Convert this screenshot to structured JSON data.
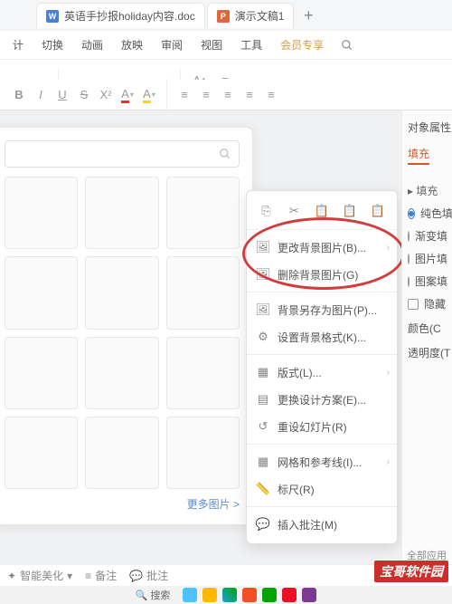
{
  "tabs": [
    {
      "icon": "W",
      "title": "英语手抄报holiday内容.doc"
    },
    {
      "icon": "P",
      "title": "演示文稿1"
    }
  ],
  "addTab": "+",
  "menubar": [
    "计",
    "切换",
    "动画",
    "放映",
    "审阅",
    "视图",
    "工具",
    "会员专享"
  ],
  "pickerMore": "更多图片 >",
  "contextMenu": {
    "items": [
      {
        "icon": "img-edit",
        "label": "更改背景图片(B)...",
        "arrow": true
      },
      {
        "icon": "img-del",
        "label": "删除背景图片(G)"
      },
      {
        "sep": true
      },
      {
        "icon": "img-save",
        "label": "背景另存为图片(P)..."
      },
      {
        "icon": "img-fmt",
        "label": "设置背景格式(K)..."
      },
      {
        "sep": true
      },
      {
        "icon": "layout",
        "label": "版式(L)...",
        "arrow": true
      },
      {
        "icon": "design",
        "label": "更换设计方案(E)..."
      },
      {
        "icon": "reset",
        "label": "重设幻灯片(R)"
      },
      {
        "sep": true
      },
      {
        "icon": "grid",
        "label": "网格和参考线(I)...",
        "arrow": true
      },
      {
        "icon": "ruler",
        "label": "标尺(R)"
      },
      {
        "sep": true
      },
      {
        "icon": "comment",
        "label": "插入批注(M)"
      }
    ]
  },
  "rightPanel": {
    "title": "对象属性",
    "tab": "填充",
    "section": "填充",
    "options": [
      "纯色填",
      "渐变填",
      "图片填",
      "图案填"
    ],
    "hideLabel": "隐藏",
    "colorLabel": "颜色(C",
    "opacityLabel": "透明度(T"
  },
  "bottomBar": {
    "beautify": "智能美化",
    "notes": "备注",
    "comments": "批注"
  },
  "taskbar": {
    "search": "搜索"
  },
  "allApps": "全部应用",
  "watermark": "宝哥软件园"
}
